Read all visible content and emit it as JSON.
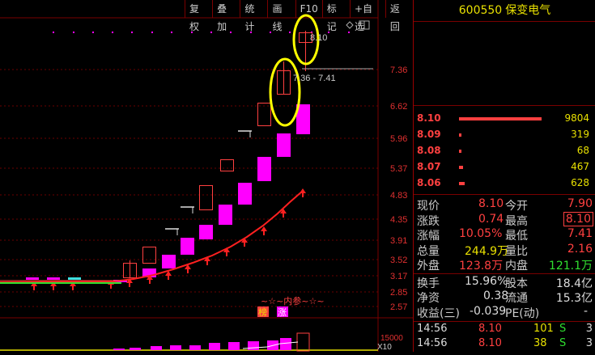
{
  "toolbar": [
    "复权",
    "叠加",
    "统计",
    "画线",
    "F10",
    "标记",
    "+自选",
    "返回"
  ],
  "price_axis": [
    "7.36",
    "6.62",
    "5.96",
    "5.37",
    "4.83",
    "4.35",
    "3.91",
    "3.52",
    "3.17",
    "2.85",
    "2.57"
  ],
  "annotations": {
    "high_label": "8.10",
    "range_label": "7.36 - 7.41",
    "signal_text": "~☆~内参~☆~",
    "badge_1": "榜",
    "badge_2": "涨",
    "volume_label": "15000",
    "volume_unit": "X10"
  },
  "stock": {
    "code": "600550",
    "name": "保变电气"
  },
  "order_book": [
    {
      "price": "8.10",
      "volume": "9804",
      "bar": 100
    },
    {
      "price": "8.09",
      "volume": "319",
      "bar": 3.3
    },
    {
      "price": "8.08",
      "volume": "68",
      "bar": 0.7
    },
    {
      "price": "8.07",
      "volume": "467",
      "bar": 4.8
    },
    {
      "price": "8.06",
      "volume": "628",
      "bar": 6.4
    }
  ],
  "quote": {
    "r1": {
      "l1": "现价",
      "v1": "8.10",
      "l2": "今开",
      "v2": "7.90"
    },
    "r2": {
      "l1": "涨跌",
      "v1": "0.74",
      "l2": "最高",
      "v2": "8.10"
    },
    "r3": {
      "l1": "涨幅",
      "v1": "10.05%",
      "l2": "最低",
      "v2": "7.41"
    },
    "r4": {
      "l1": "总量",
      "v1": "244.9万",
      "l2": "量比",
      "v2": "2.16"
    },
    "r5": {
      "l1": "外盘",
      "v1": "123.8万",
      "l2": "内盘",
      "v2": "121.1万"
    },
    "r6": {
      "l1": "换手",
      "v1": "15.96%",
      "l2": "股本",
      "v2": "18.4亿"
    },
    "r7": {
      "l1": "净资",
      "v1": "0.38",
      "l2": "流通",
      "v2": "15.3亿"
    },
    "r8": {
      "l1": "收益(三)",
      "v1": "-0.039",
      "l2": "PE(动)",
      "v2": "-"
    }
  },
  "ticks": [
    {
      "time": "14:56",
      "price": "8.10",
      "vol": "101",
      "side": "S",
      "n": "3"
    },
    {
      "time": "14:56",
      "price": "8.10",
      "vol": "38",
      "side": "S",
      "n": "3"
    }
  ],
  "colors": {
    "up": "#ff4040",
    "magenta": "#ff00ff",
    "yellow": "#e8e000",
    "grid": "#7a0000",
    "ma": "#ff2020"
  }
}
